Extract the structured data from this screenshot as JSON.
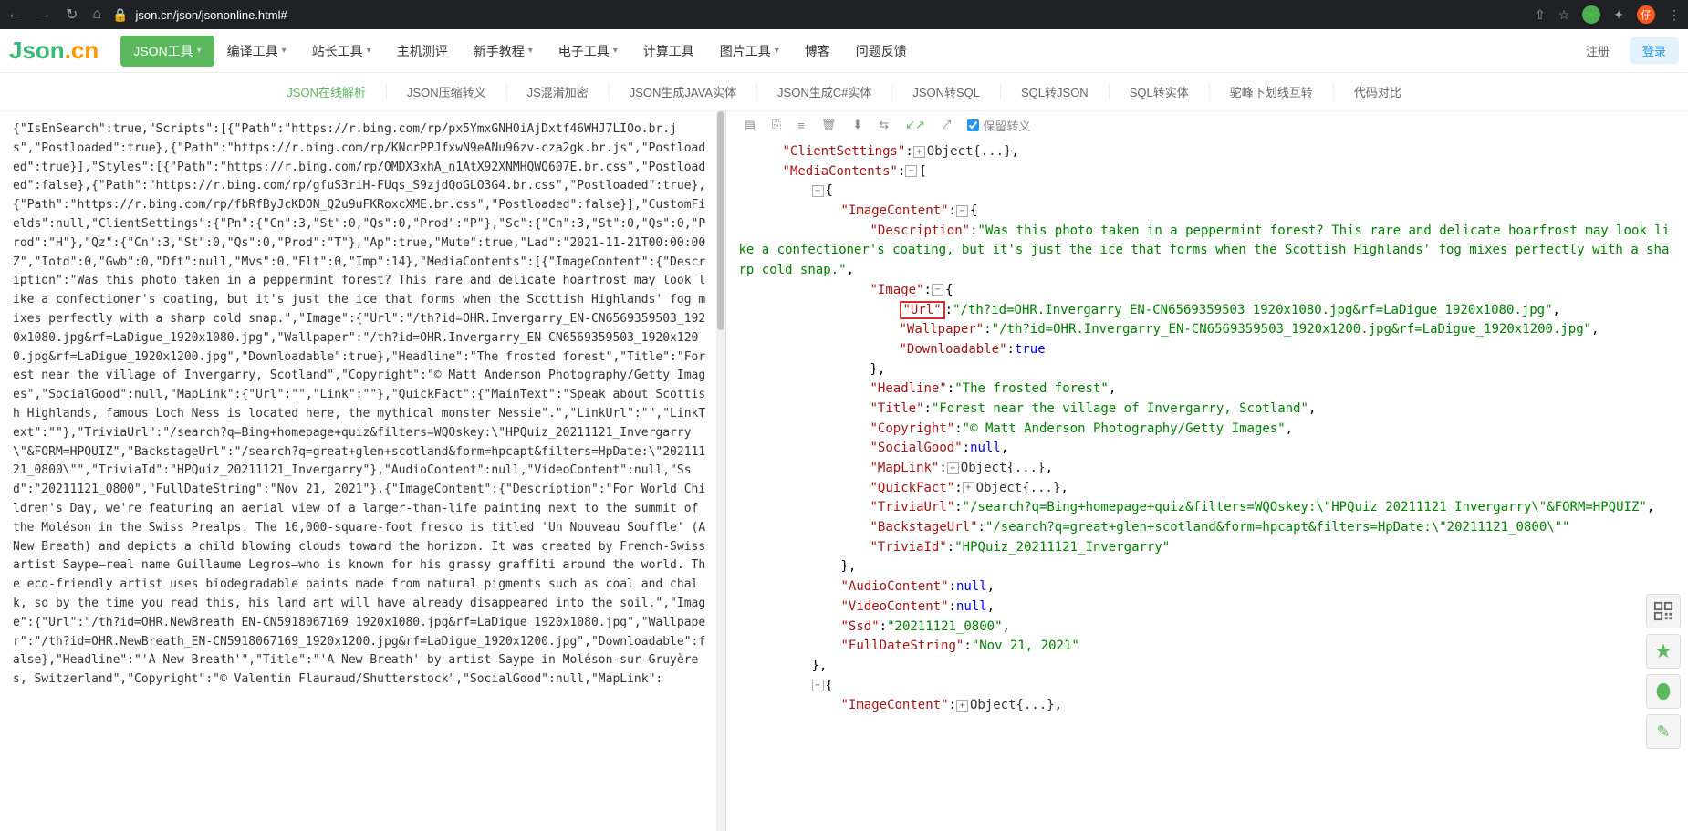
{
  "browser": {
    "url": "json.cn/json/jsononline.html#",
    "user_initial": "仔"
  },
  "header": {
    "logo_a": "Json",
    "logo_b": ".cn",
    "menu": [
      {
        "label": "JSON工具",
        "caret": true,
        "active": true
      },
      {
        "label": "编译工具",
        "caret": true
      },
      {
        "label": "站长工具",
        "caret": true
      },
      {
        "label": "主机测评"
      },
      {
        "label": "新手教程",
        "caret": true
      },
      {
        "label": "电子工具",
        "caret": true
      },
      {
        "label": "计算工具"
      },
      {
        "label": "图片工具",
        "caret": true
      },
      {
        "label": "博客"
      },
      {
        "label": "问题反馈"
      }
    ],
    "register": "注册",
    "login": "登录"
  },
  "subnav": [
    {
      "label": "JSON在线解析",
      "active": true
    },
    {
      "label": "JSON压缩转义"
    },
    {
      "label": "JS混淆加密"
    },
    {
      "label": "JSON生成JAVA实体"
    },
    {
      "label": "JSON生成C#实体"
    },
    {
      "label": "JSON转SQL"
    },
    {
      "label": "SQL转JSON"
    },
    {
      "label": "SQL转实体"
    },
    {
      "label": "驼峰下划线互转"
    },
    {
      "label": "代码对比"
    }
  ],
  "toolbar": {
    "keep_escape": "保留转义"
  },
  "raw_json": "{\"IsEnSearch\":true,\"Scripts\":[{\"Path\":\"https://r.bing.com/rp/px5YmxGNH0iAjDxtf46WHJ7LIOo.br.js\",\"Postloaded\":true},{\"Path\":\"https://r.bing.com/rp/KNcrPPJfxwN9eANu96zv-cza2gk.br.js\",\"Postloaded\":true}],\"Styles\":[{\"Path\":\"https://r.bing.com/rp/OMDX3xhA_n1AtX92XNMHQWQ607E.br.css\",\"Postloaded\":false},{\"Path\":\"https://r.bing.com/rp/gfuS3riH-FUqs_S9zjdQoGLO3G4.br.css\",\"Postloaded\":true},{\"Path\":\"https://r.bing.com/rp/fbRfByJcKDON_Q2u9uFKRoxcXME.br.css\",\"Postloaded\":false}],\"CustomFields\":null,\"ClientSettings\":{\"Pn\":{\"Cn\":3,\"St\":0,\"Qs\":0,\"Prod\":\"P\"},\"Sc\":{\"Cn\":3,\"St\":0,\"Qs\":0,\"Prod\":\"H\"},\"Qz\":{\"Cn\":3,\"St\":0,\"Qs\":0,\"Prod\":\"T\"},\"Ap\":true,\"Mute\":true,\"Lad\":\"2021-11-21T00:00:00Z\",\"Iotd\":0,\"Gwb\":0,\"Dft\":null,\"Mvs\":0,\"Flt\":0,\"Imp\":14},\"MediaContents\":[{\"ImageContent\":{\"Description\":\"Was this photo taken in a peppermint forest? This rare and delicate hoarfrost may look like a confectioner's coating, but it's just the ice that forms when the Scottish Highlands' fog mixes perfectly with a sharp cold snap.\",\"Image\":{\"Url\":\"/th?id=OHR.Invergarry_EN-CN6569359503_1920x1080.jpg&rf=LaDigue_1920x1080.jpg\",\"Wallpaper\":\"/th?id=OHR.Invergarry_EN-CN6569359503_1920x1200.jpg&rf=LaDigue_1920x1200.jpg\",\"Downloadable\":true},\"Headline\":\"The frosted forest\",\"Title\":\"Forest near the village of Invergarry, Scotland\",\"Copyright\":\"© Matt Anderson Photography/Getty Images\",\"SocialGood\":null,\"MapLink\":{\"Url\":\"\",\"Link\":\"\"},\"QuickFact\":{\"MainText\":\"Speak about Scottish Highlands, famous Loch Ness is located here, the mythical monster Nessie\".\",\"LinkUrl\":\"\",\"LinkText\":\"\"},\"TriviaUrl\":\"/search?q=Bing+homepage+quiz&filters=WQOskey:\\\"HPQuiz_20211121_Invergarry\\\"&FORM=HPQUIZ\",\"BackstageUrl\":\"/search?q=great+glen+scotland&form=hpcapt&filters=HpDate:\\\"20211121_0800\\\"\",\"TriviaId\":\"HPQuiz_20211121_Invergarry\"},\"AudioContent\":null,\"VideoContent\":null,\"Ssd\":\"20211121_0800\",\"FullDateString\":\"Nov 21, 2021\"},{\"ImageContent\":{\"Description\":\"For World Children's Day, we're featuring an aerial view of a larger-than-life painting next to the summit of the Moléson in the Swiss Prealps. The 16,000-square-foot fresco is titled 'Un Nouveau Souffle' (A New Breath) and depicts a child blowing clouds toward the horizon. It was created by French-Swiss artist Saype—real name Guillaume Legros—who is known for his grassy graffiti around the world. The eco-friendly artist uses biodegradable paints made from natural pigments such as coal and chalk, so by the time you read this, his land art will have already disappeared into the soil.\",\"Image\":{\"Url\":\"/th?id=OHR.NewBreath_EN-CN5918067169_1920x1080.jpg&rf=LaDigue_1920x1080.jpg\",\"Wallpaper\":\"/th?id=OHR.NewBreath_EN-CN5918067169_1920x1200.jpg&rf=LaDigue_1920x1200.jpg\",\"Downloadable\":false},\"Headline\":\"'A New Breath'\",\"Title\":\"'A New Breath' by artist Saype in Moléson-sur-Gruyères, Switzerland\",\"Copyright\":\"© Valentin Flauraud/Shutterstock\",\"SocialGood\":null,\"MapLink\":",
  "tree": {
    "ClientSettings": "Object{...}",
    "MediaContents_open": "[",
    "Description_key": "\"Description\"",
    "Description_val": "\"Was this photo taken in a peppermint forest? This rare and delicate hoarfrost may look like a confectioner's coating, but it's just the ice that forms when the Scottish Highlands' fog mixes perfectly with a sharp cold snap.\"",
    "Image_key": "\"Image\"",
    "Url_key": "\"Url\"",
    "Url_val": "\"/th?id=OHR.Invergarry_EN-CN6569359503_1920x1080.jpg&rf=LaDigue_1920x1080.jpg\"",
    "Wallpaper_key": "\"Wallpaper\"",
    "Wallpaper_val": "\"/th?id=OHR.Invergarry_EN-CN6569359503_1920x1200.jpg&rf=LaDigue_1920x1200.jpg\"",
    "Downloadable_key": "\"Downloadable\"",
    "Downloadable_val": "true",
    "Headline_key": "\"Headline\"",
    "Headline_val": "\"The frosted forest\"",
    "Title_key": "\"Title\"",
    "Title_val": "\"Forest near the village of Invergarry, Scotland\"",
    "Copyright_key": "\"Copyright\"",
    "Copyright_val": "\"© Matt Anderson Photography/Getty Images\"",
    "SocialGood_key": "\"SocialGood\"",
    "SocialGood_val": "null",
    "MapLink_key": "\"MapLink\"",
    "MapLink_val": "Object{...}",
    "QuickFact_key": "\"QuickFact\"",
    "QuickFact_val": "Object{...}",
    "TriviaUrl_key": "\"TriviaUrl\"",
    "TriviaUrl_val": "\"/search?q=Bing+homepage+quiz&filters=WQOskey:\\\"HPQuiz_20211121_Invergarry\\\"&FORM=HPQUIZ\"",
    "BackstageUrl_key": "\"BackstageUrl\"",
    "BackstageUrl_val": "\"/search?q=great+glen+scotland&form=hpcapt&filters=HpDate:\\\"20211121_0800\\\"\"",
    "TriviaId_key": "\"TriviaId\"",
    "TriviaId_val": "\"HPQuiz_20211121_Invergarry\"",
    "AudioContent_key": "\"AudioContent\"",
    "AudioContent_val": "null",
    "VideoContent_key": "\"VideoContent\"",
    "VideoContent_val": "null",
    "Ssd_key": "\"Ssd\"",
    "Ssd_val": "\"20211121_0800\"",
    "FullDateString_key": "\"FullDateString\"",
    "FullDateString_val": "\"Nov 21, 2021\"",
    "ImageContent2_key": "\"ImageContent\"",
    "ImageContent2_val": "Object{...}"
  }
}
